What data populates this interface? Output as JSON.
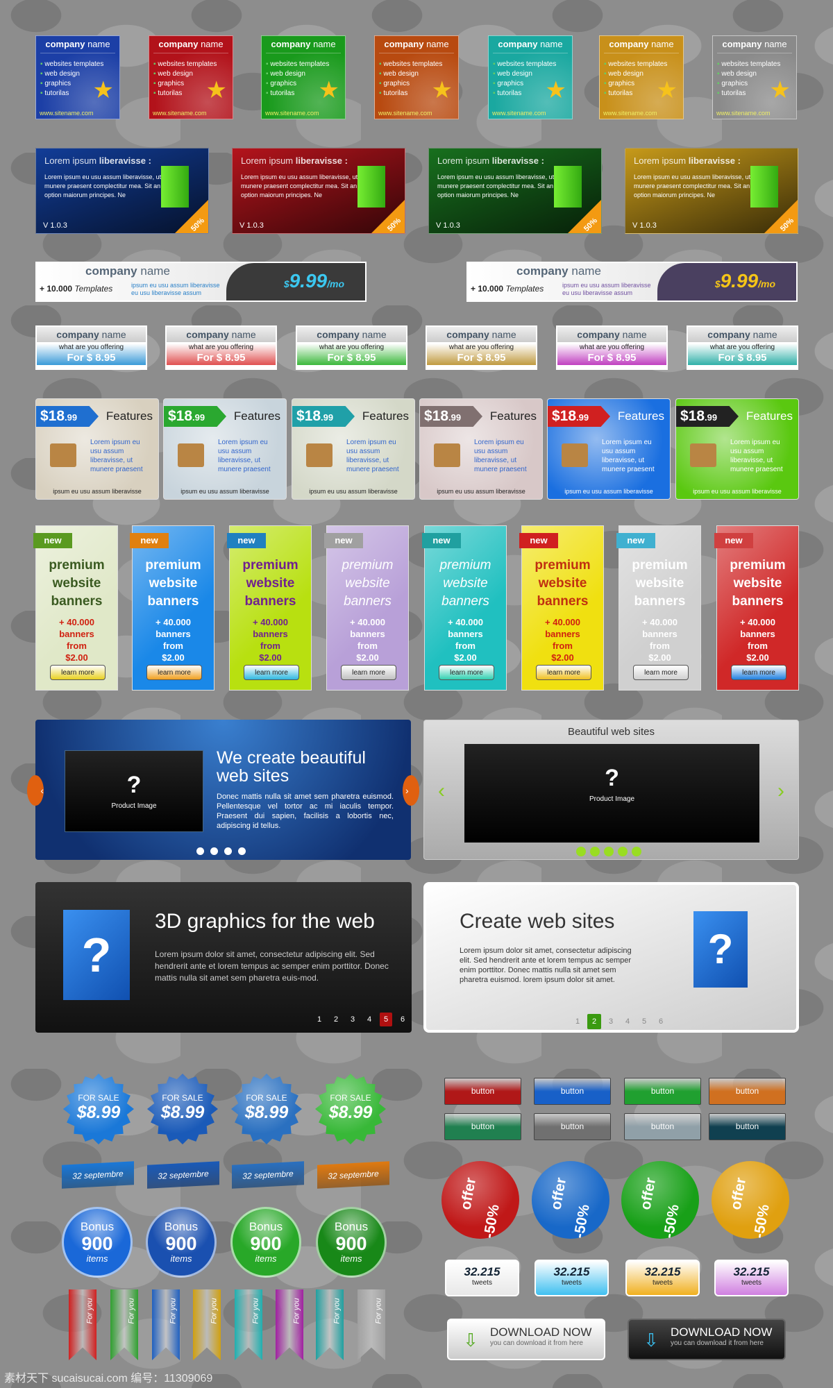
{
  "square_cards": {
    "title_bold": "company",
    "title_rest": "name",
    "items": [
      "websites templates",
      "web design",
      "graphics",
      "tutorilas"
    ],
    "url": "www.sitename.com",
    "colors": [
      "#1c3fa6",
      "#b2121a",
      "#199a1c",
      "#b84a10",
      "#1aa8a0",
      "#c8901a",
      "#8a8a8a"
    ]
  },
  "lorem_banners": {
    "title_light": "Lorem ipsum",
    "title_bold": "liberavisse :",
    "body": "Lorem ipsum eu usu assum liberavisse, ut munere praesent complectitur mea. Sit an option maiorum principes. Ne",
    "version": "V 1.0.3",
    "discount": "50%",
    "colors": [
      "#123d98",
      "#b4141c",
      "#18701e",
      "#c79a1a"
    ]
  },
  "wide_banners": [
    {
      "company_bold": "company",
      "company_rest": "name",
      "templates_bold": "+ 10.000",
      "templates_italic": "Templates",
      "lines": [
        "ipsum eu usu assum liberavisse",
        "eu usu liberavisse assum"
      ],
      "price_cur": "$",
      "price": "9.99",
      "price_unit": "/mo",
      "accent": "#3cc8f0",
      "dark": "#3a3a3a"
    },
    {
      "company_bold": "company",
      "company_rest": "name",
      "templates_bold": "+ 10.000",
      "templates_italic": "Templates",
      "lines": [
        "ipsum eu usu assum liberavisse",
        "eu usu liberavisse assum"
      ],
      "price_cur": "$",
      "price": "9.99",
      "price_unit": "/mo",
      "accent": "#f5c518",
      "dark": "#4a4060"
    }
  ],
  "offer_boxes": {
    "company_bold": "company",
    "company_rest": "name",
    "what": "what are you offering",
    "price": "For $ 8.95",
    "colors": [
      "#3a9ad8",
      "#e05050",
      "#3cb83c",
      "#c09a40",
      "#c040c0",
      "#30b0a8"
    ]
  },
  "feature_boxes": {
    "price": "$18",
    "cents": ".99",
    "label": "Features",
    "text": "Lorem ipsum eu usu assum liberavisse, ut munere praesent",
    "footer": "ipsum eu usu assum liberavisse",
    "tag_colors": [
      "#1f6fd0",
      "#2aa830",
      "#20a0a8",
      "#807070",
      "#d02020",
      "#222222"
    ],
    "bg_colors": [
      "#d8d0bf",
      "#c8d4dc",
      "#d4d8c8",
      "#d8c8c8",
      "#1a6fe0",
      "#5ac810"
    ]
  },
  "vertical_banners": {
    "badge": "new",
    "title": [
      "premium",
      "website",
      "banners"
    ],
    "offer": [
      "+ 40.000",
      "banners",
      "from",
      "$2.00"
    ],
    "button": "learn more",
    "bg": [
      "#e0e8c8",
      "#1a88e8",
      "#b8e010",
      "#b8a0d8",
      "#20c0c0",
      "#f0e010",
      "#d0d0d0",
      "#d02828"
    ],
    "text": [
      "#3a5a20",
      "#ffffff",
      "#702090",
      "#ffffff",
      "#ffffff",
      "#c03010",
      "#ffffff",
      "#ffffff"
    ]
  },
  "slider_blue": {
    "title": "We create beautiful web sites",
    "body": "Donec mattis nulla sit amet sem pharetra euismod. Pellentesque vel tortor ac mi iaculis tempor. Praesent dui sapien, facilisis a lobortis nec, adipiscing id tellus.",
    "image_mark": "?",
    "image_label": "Product Image",
    "dots": 4
  },
  "slider_gray": {
    "title": "Beautiful web sites",
    "image_mark": "?",
    "image_label": "Product Image",
    "dots": 5
  },
  "slider_dark": {
    "title": "3D graphics for the web",
    "body": "Lorem ipsum dolor sit amet, consectetur adipiscing elit. Sed hendrerit ante et lorem tempus ac semper enim porttitor. Donec mattis nulla sit amet sem pharetra euis-mod.",
    "mark": "?",
    "pages": [
      "1",
      "2",
      "3",
      "4",
      "5",
      "6"
    ],
    "active_page": "5"
  },
  "slider_light": {
    "title": "Create web sites",
    "body": "Lorem ipsum dolor sit amet, consectetur adipiscing elit. Sed hendrerit ante et lorem tempus ac semper enim porttitor. Donec mattis nulla sit amet sem pharetra euismod. lorem ipsum dolor sit amet.",
    "mark": "?",
    "pages": [
      "1",
      "2",
      "3",
      "4",
      "5",
      "6"
    ],
    "active_page": "2"
  },
  "sale_badges": {
    "label": "FOR SALE",
    "price": "$8.99",
    "colors": [
      "#1a78d8",
      "#1a5ab8",
      "#2a70c0",
      "#38b838"
    ]
  },
  "date_ribbons": {
    "label": "32 septembre",
    "colors": [
      "#1a78d8",
      "#1a5ab8",
      "#2a70c0",
      "#e07a10"
    ]
  },
  "bonus_circles": {
    "label": "Bonus",
    "value": "900",
    "unit": "items",
    "colors": [
      "#1a68d8",
      "#1a50b0",
      "#28a828",
      "#188818"
    ]
  },
  "bookmarks": {
    "label": "For you",
    "colors": [
      "#d02020",
      "#30a030",
      "#2060c0",
      "#d0a010",
      "#20b0b0",
      "#a020a0",
      "#20a0a0",
      "#a0a0a0"
    ]
  },
  "buttons": {
    "label": "button",
    "colors": [
      "#b01818",
      "#1860c8",
      "#20a030",
      "#d07020",
      "#208050",
      "#707070",
      "#90a0a8",
      "#104050"
    ]
  },
  "offer_stickers": {
    "label": "offer",
    "discount": "-50%",
    "colors": [
      "#c01818",
      "#1868c8",
      "#18a018",
      "#e0a010"
    ]
  },
  "tweet_badges": {
    "count": "32.215",
    "label": "tweets",
    "colors": [
      "#e8e8e8",
      "#40c0f0",
      "#f0b020",
      "#d080e0"
    ]
  },
  "download_buttons": [
    {
      "title": "DOWNLOAD NOW",
      "subtitle": "you can download it from here",
      "theme": "light"
    },
    {
      "title": "DOWNLOAD NOW",
      "subtitle": "you can download it from here",
      "theme": "dark"
    }
  ],
  "watermark": "素材天下 sucaisucai.com  编号：11309069"
}
